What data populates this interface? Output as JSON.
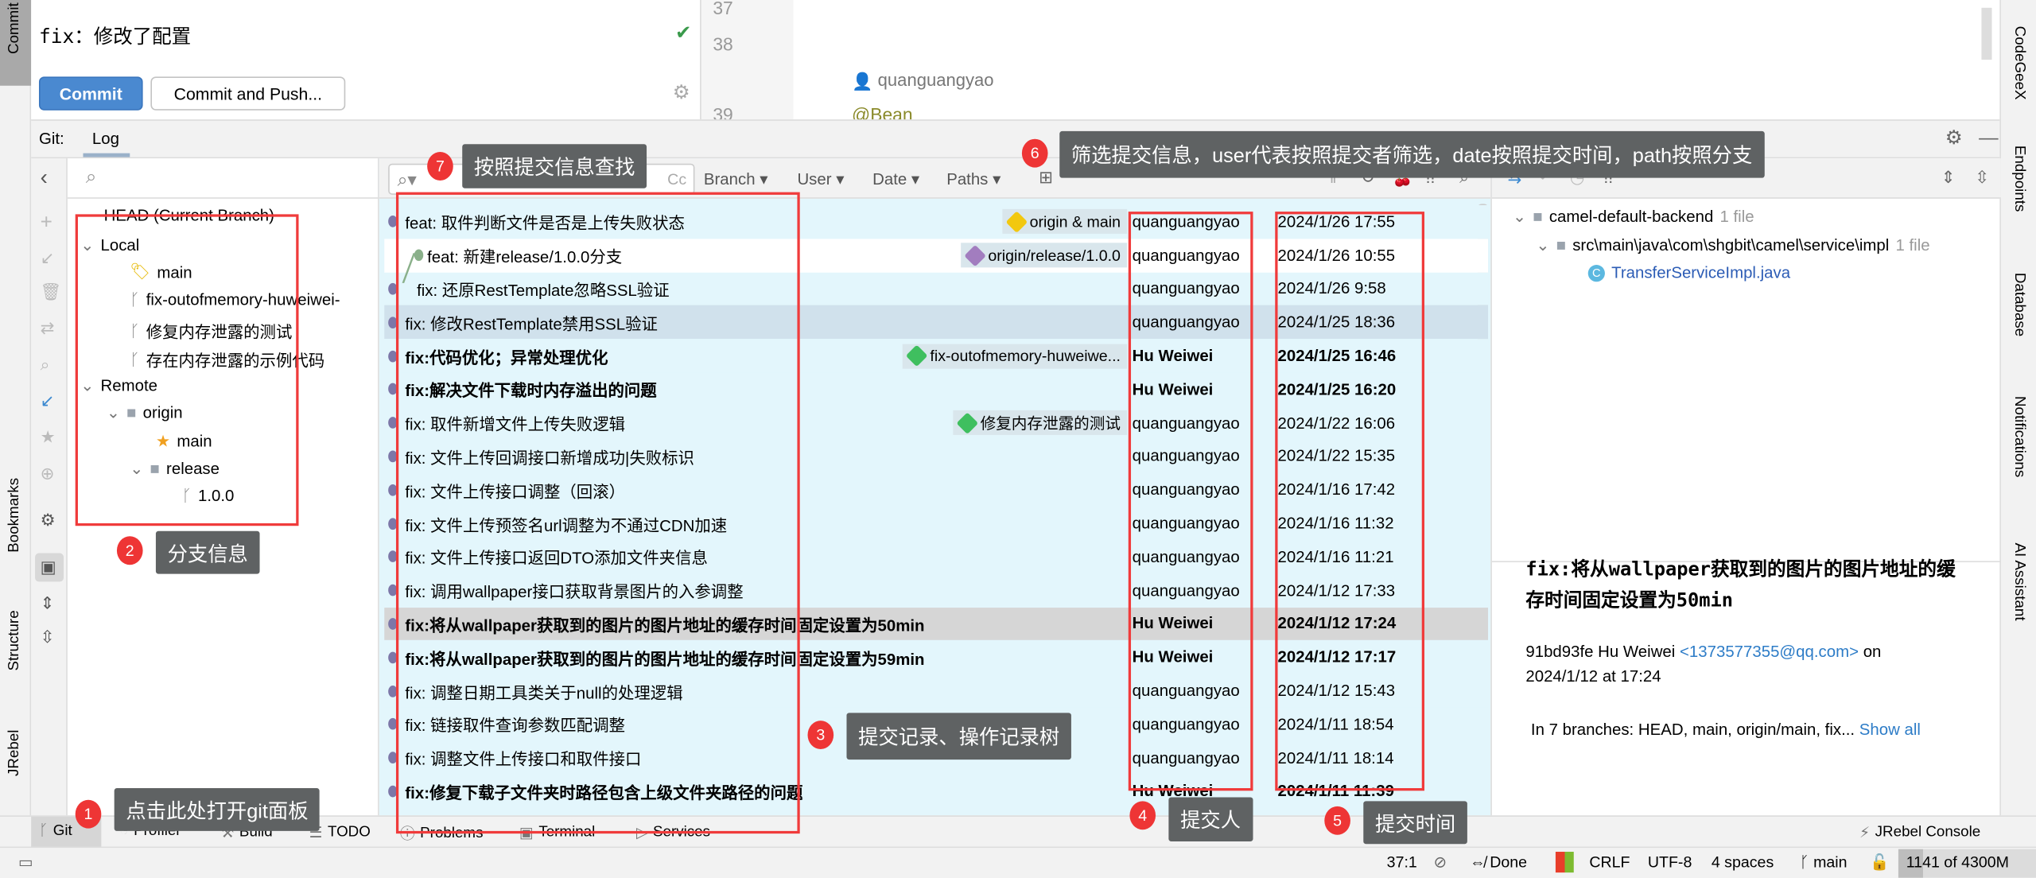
{
  "left_strip": {
    "commit_tab": "Commit",
    "tabs": [
      "Bookmarks",
      "Structure",
      "JRebel"
    ]
  },
  "right_strip": {
    "tabs": [
      "CodeGeeX",
      "Endpoints",
      "Database",
      "Notifications",
      "AI Assistant"
    ]
  },
  "commit_panel": {
    "message": "fix：修改了配置",
    "commit_label": "Commit",
    "commit_push_label": "Commit and Push..."
  },
  "editor": {
    "line_numbers": [
      "37",
      "38",
      "39"
    ],
    "author_hint": "quanguangyao",
    "code": "@Bean"
  },
  "git_header": {
    "prefix": "Git:",
    "tab": "Log"
  },
  "branches": {
    "head": "HEAD (Current Branch)",
    "local_label": "Local",
    "local": [
      "main",
      "fix-outofmemory-huweiwei-",
      "修复内存泄露的测试",
      "存在内存泄露的示例代码"
    ],
    "remote_label": "Remote",
    "origin": "origin",
    "origin_main": "main",
    "release": "release",
    "release_version": "1.0.0"
  },
  "filters": {
    "branch": "Branch",
    "user": "User",
    "date": "Date",
    "paths": "Paths",
    "case": "Cc"
  },
  "commits": [
    {
      "msg": "feat: 取件判断文件是否是上传失败状态",
      "author": "quanguangyao",
      "date": "2024/1/26 17:55",
      "ref": "origin & main",
      "ref_color": "#f2c80f",
      "bg": "#e3f6fc"
    },
    {
      "msg": "feat: 新建release/1.0.0分支",
      "author": "quanguangyao",
      "date": "2024/1/26 10:55",
      "ref": "origin/release/1.0.0",
      "ref_color": "#a27dbf",
      "bg": "#ffffff",
      "indent": true
    },
    {
      "msg": "fix: 还原RestTemplate忽略SSL验证",
      "author": "quanguangyao",
      "date": "2024/1/26 9:58",
      "bg": "#e3f6fc",
      "indent2": true
    },
    {
      "msg": "fix: 修改RestTemplate禁用SSL验证",
      "author": "quanguangyao",
      "date": "2024/1/25 18:36",
      "bg": "#d0e1ec"
    },
    {
      "msg": "fix:代码优化；异常处理优化",
      "author": "Hu Weiwei",
      "date": "2024/1/25 16:46",
      "ref": "fix-outofmemory-huweiwe...",
      "ref_color": "#3fbf5f",
      "bg": "#e3f6fc",
      "bold": true
    },
    {
      "msg": "fix:解决文件下载时内存溢出的问题",
      "author": "Hu Weiwei",
      "date": "2024/1/25 16:20",
      "bg": "#e3f6fc",
      "bold": true
    },
    {
      "msg": "fix: 取件新增文件上传失败逻辑",
      "author": "quanguangyao",
      "date": "2024/1/22 16:06",
      "ref": "修复内存泄露的测试",
      "ref_color": "#3fbf5f",
      "bg": "#e3f6fc"
    },
    {
      "msg": "fix: 文件上传回调接口新增成功|失败标识",
      "author": "quanguangyao",
      "date": "2024/1/22 15:35",
      "bg": "#e3f6fc"
    },
    {
      "msg": "fix: 文件上传接口调整（回滚）",
      "author": "quanguangyao",
      "date": "2024/1/16 17:42",
      "bg": "#e3f6fc"
    },
    {
      "msg": "fix: 文件上传预签名url调整为不通过CDN加速",
      "author": "quanguangyao",
      "date": "2024/1/16 11:32",
      "bg": "#e3f6fc"
    },
    {
      "msg": "fix: 文件上传接口返回DTO添加文件夹信息",
      "author": "quanguangyao",
      "date": "2024/1/16 11:21",
      "bg": "#e3f6fc"
    },
    {
      "msg": "fix: 调用wallpaper接口获取背景图片的入参调整",
      "author": "quanguangyao",
      "date": "2024/1/12 17:33",
      "bg": "#e3f6fc"
    },
    {
      "msg": "fix:将从wallpaper获取到的图片的图片地址的缓存时间固定设置为50min",
      "author": "Hu Weiwei",
      "date": "2024/1/12 17:24",
      "bg": "#d6d6d6",
      "bold": true
    },
    {
      "msg": "fix:将从wallpaper获取到的图片的图片地址的缓存时间固定设置为59min",
      "author": "Hu Weiwei",
      "date": "2024/1/12 17:17",
      "bg": "#e3f6fc",
      "bold": true
    },
    {
      "msg": "fix: 调整日期工具类关于null的处理逻辑",
      "author": "quanguangyao",
      "date": "2024/1/12 15:43",
      "bg": "#e3f6fc"
    },
    {
      "msg": "fix: 链接取件查询参数匹配调整",
      "author": "quanguangyao",
      "date": "2024/1/11 18:54",
      "bg": "#e3f6fc"
    },
    {
      "msg": "fix: 调整文件上传接口和取件接口",
      "author": "quanguangyao",
      "date": "2024/1/11 18:14",
      "bg": "#e3f6fc"
    },
    {
      "msg": "fix:修复下载子文件夹时路径包含上级文件夹路径的问题",
      "author": "Hu Weiwei",
      "date": "2024/1/11 11:39",
      "bg": "#e3f6fc",
      "bold": true
    }
  ],
  "details": {
    "project": "camel-default-backend",
    "project_count": "1 file",
    "path": "src\\main\\java\\com\\shgbit\\camel\\service\\impl",
    "path_count": "1 file",
    "file": "TransferServiceImpl.java",
    "subject": "fix:将从wallpaper获取到的图片的图片地址的缓存时间固定设置为50min",
    "hash_author": "91bd93fe Hu Weiwei",
    "email": "<1373577355@qq.com>",
    "on": "on",
    "date": "2024/1/12 at 17:24",
    "branches": "In 7 branches: HEAD, main, origin/main, fix...",
    "show_all": "Show all"
  },
  "bottom_tools": [
    "Git",
    "Profiler",
    "Build",
    "TODO",
    "Problems",
    "Terminal",
    "Services"
  ],
  "jrebel_console": "JRebel Console",
  "status": {
    "position": "37:1",
    "done": "Done",
    "line_sep": "CRLF",
    "encoding": "UTF-8",
    "indent": "4 spaces",
    "branch": "main",
    "memory": "1141 of 4300M"
  },
  "annotations": [
    {
      "n": "1",
      "text": "点击此处打开git面板"
    },
    {
      "n": "2",
      "text": "分支信息"
    },
    {
      "n": "3",
      "text": "提交记录、操作记录树"
    },
    {
      "n": "4",
      "text": "提交人"
    },
    {
      "n": "5",
      "text": "提交时间"
    },
    {
      "n": "6",
      "text": "筛选提交信息，user代表按照提交者筛选，date按照提交时间，path按照分支"
    },
    {
      "n": "7",
      "text": "按照提交信息查找"
    }
  ]
}
